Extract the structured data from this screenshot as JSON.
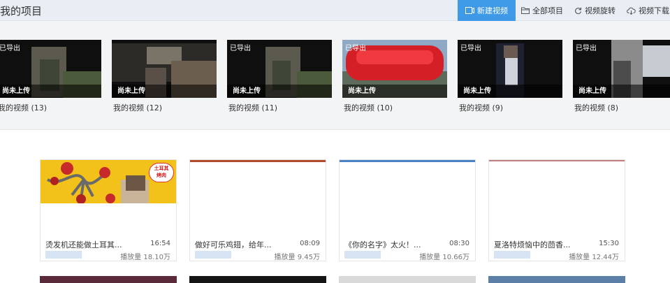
{
  "header": {
    "title": "我的项目",
    "toolbar": [
      {
        "label": "新建视频",
        "icon": "video-plus-icon",
        "primary": true
      },
      {
        "label": "全部项目",
        "icon": "folder-icon",
        "primary": false
      },
      {
        "label": "视频旋转",
        "icon": "rotate-icon",
        "primary": false
      },
      {
        "label": "视频下载",
        "icon": "cloud-download-icon",
        "primary": false
      }
    ]
  },
  "projects": [
    {
      "name": "我的视频 (13)",
      "exported": "已导出",
      "upload_status": "尚未上传"
    },
    {
      "name": "我的视频 (12)",
      "exported": "",
      "upload_status": "尚未上传"
    },
    {
      "name": "我的视频 (11)",
      "exported": "已导出",
      "upload_status": "尚未上传"
    },
    {
      "name": "我的视频 (10)",
      "exported": "已导出",
      "upload_status": "尚未上传"
    },
    {
      "name": "我的视频 (9)",
      "exported": "已导出",
      "upload_status": "尚未上传"
    },
    {
      "name": "我的视频 (8)",
      "exported": "已导出",
      "upload_status": "尚未上传"
    }
  ],
  "videos": [
    {
      "title": "烫发机还能做土耳其...",
      "duration": "16:54",
      "plays": "播放量 18.10万",
      "badge": "土耳其烤肉"
    },
    {
      "title": "做好可乐鸡翅，给年...",
      "duration": "08:09",
      "plays": "播放量 9.45万"
    },
    {
      "title": "《你的名字》太火！...",
      "duration": "08:30",
      "plays": "播放量 10.66万"
    },
    {
      "title": "夏洛特烦恼中的茴香...",
      "duration": "15:30",
      "plays": "播放量 12.44万"
    }
  ],
  "colors": {
    "accent": "#3e9ae7",
    "header_bg": "#e9eef4",
    "strip_bg": "#f3f4f6"
  }
}
